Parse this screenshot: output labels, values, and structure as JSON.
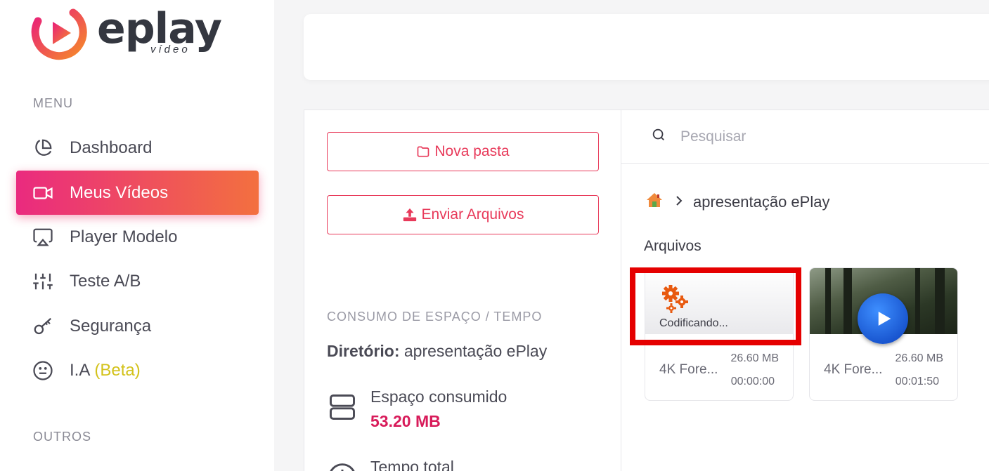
{
  "brand": {
    "name": "eplay",
    "sub": "vídeo"
  },
  "sidebar": {
    "menu_label": "MENU",
    "items": [
      {
        "label": "Dashboard",
        "icon": "pie-chart-icon"
      },
      {
        "label": "Meus Vídeos",
        "icon": "video-camera-icon",
        "active": true
      },
      {
        "label": "Player Modelo",
        "icon": "airplay-icon"
      },
      {
        "label": "Teste A/B",
        "icon": "sliders-icon"
      },
      {
        "label": "Segurança",
        "icon": "key-icon"
      },
      {
        "label": "I.A",
        "badge": "(Beta)",
        "icon": "meh-face-icon"
      }
    ],
    "others_label": "OUTROS"
  },
  "actions": {
    "new_folder": "Nova pasta",
    "upload": "Enviar Arquivos"
  },
  "usage": {
    "section_title": "CONSUMO DE ESPAÇO / TEMPO",
    "dir_label": "Diretório:",
    "dir_value": "apresentação ePlay",
    "space_label": "Espaço consumido",
    "space_value": "53.20 MB",
    "time_label": "Tempo total"
  },
  "search": {
    "placeholder": "Pesquisar"
  },
  "breadcrumb": {
    "current": "apresentação ePlay"
  },
  "files": {
    "title": "Arquivos",
    "items": [
      {
        "status": "Codificando...",
        "name": "4K Fore...",
        "size": "26.60 MB",
        "duration": "00:00:00"
      },
      {
        "name": "4K Fore...",
        "size": "26.60 MB",
        "duration": "00:01:50"
      }
    ]
  },
  "colors": {
    "accent_start": "#ea2a7f",
    "accent_end": "#f3703f",
    "danger": "#e83a5a",
    "highlight": "#e50000"
  }
}
